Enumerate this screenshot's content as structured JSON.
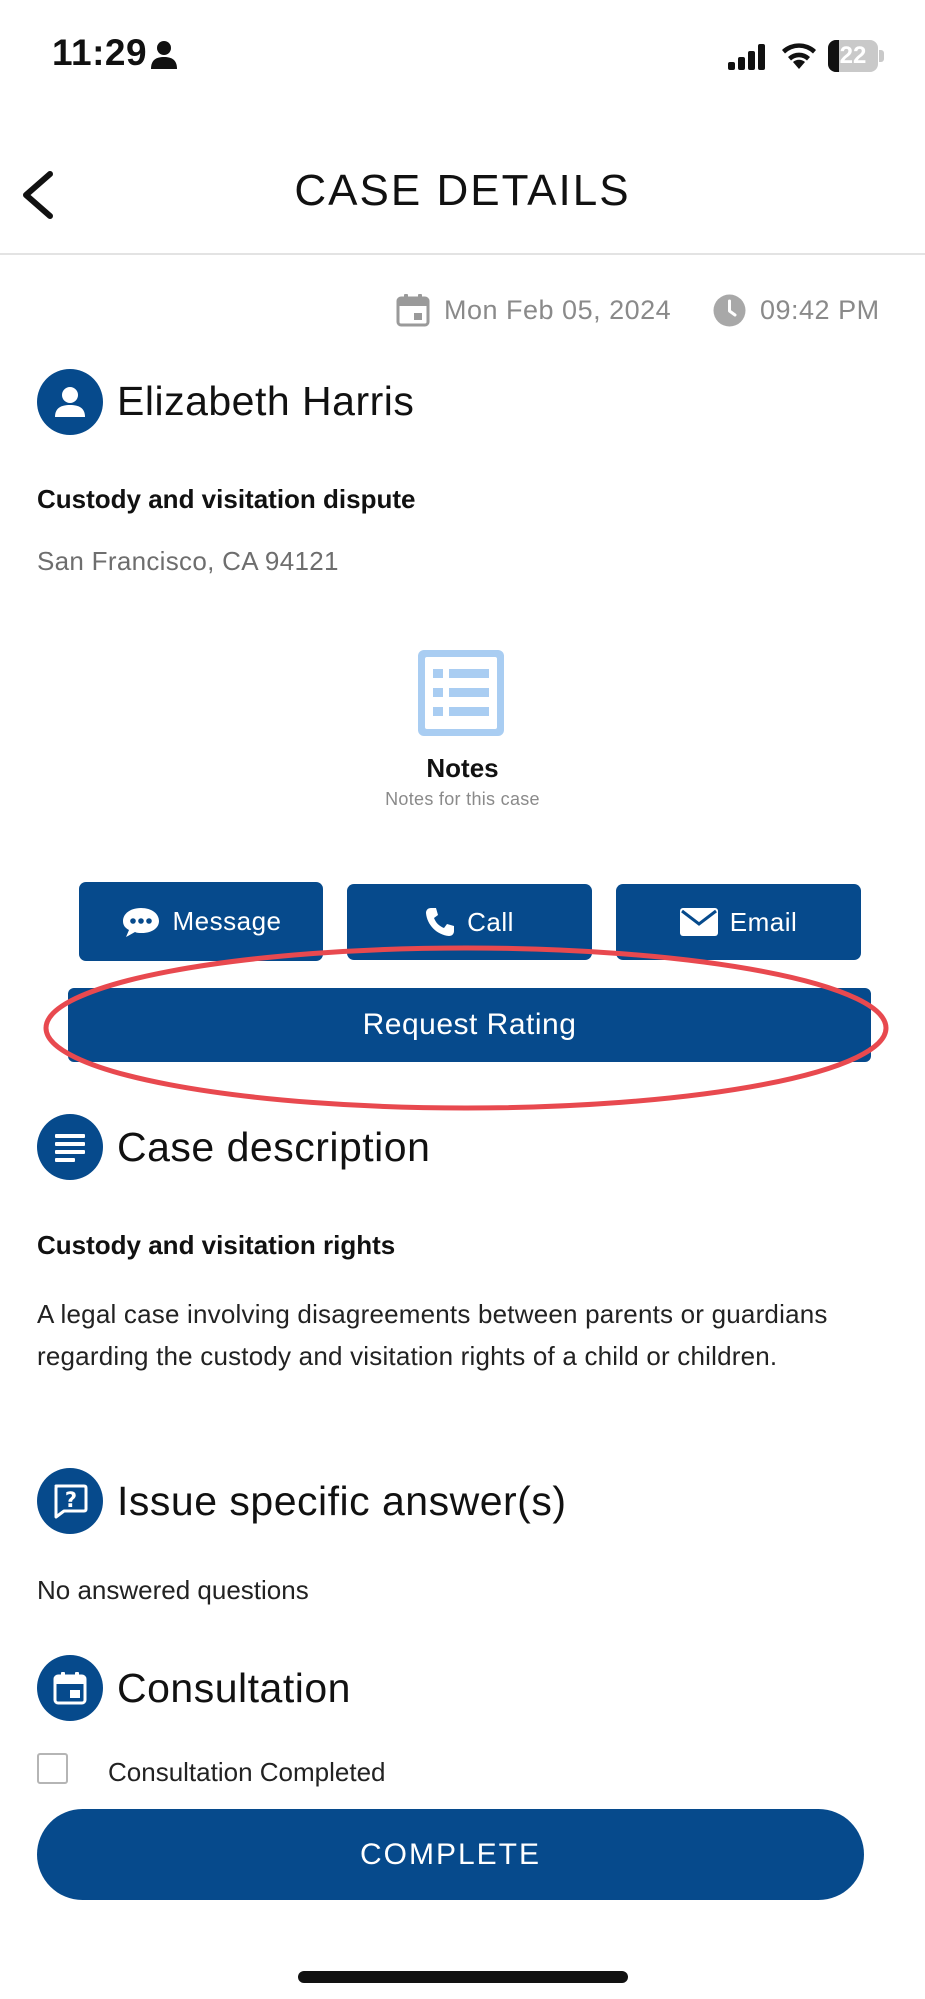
{
  "status_bar": {
    "time": "11:29",
    "battery": "22",
    "battery_level": 0.22
  },
  "header": {
    "title": "CASE DETAILS"
  },
  "case": {
    "date": "Mon Feb 05, 2024",
    "time": "09:42 PM",
    "client_name": "Elizabeth Harris",
    "case_type": "Custody and visitation dispute",
    "location": "San Francisco, CA 94121"
  },
  "notes": {
    "label": "Notes",
    "subtitle": "Notes for this case"
  },
  "actions": {
    "message": "Message",
    "call": "Call",
    "email": "Email",
    "request_rating": "Request Rating"
  },
  "case_description": {
    "title": "Case description",
    "subtitle": "Custody and visitation rights",
    "text": "A legal case involving disagreements between parents or guardians regarding the custody and visitation rights of a child or children."
  },
  "issue_answers": {
    "title": "Issue specific answer(s)",
    "empty_text": "No answered questions"
  },
  "consultation": {
    "title": "Consultation",
    "checkbox_label": "Consultation Completed",
    "checked": false
  },
  "complete_button": "COMPLETE",
  "colors": {
    "primary": "#064a8c",
    "notes_icon": "#a9cdf2",
    "highlight": "#e8494f"
  }
}
